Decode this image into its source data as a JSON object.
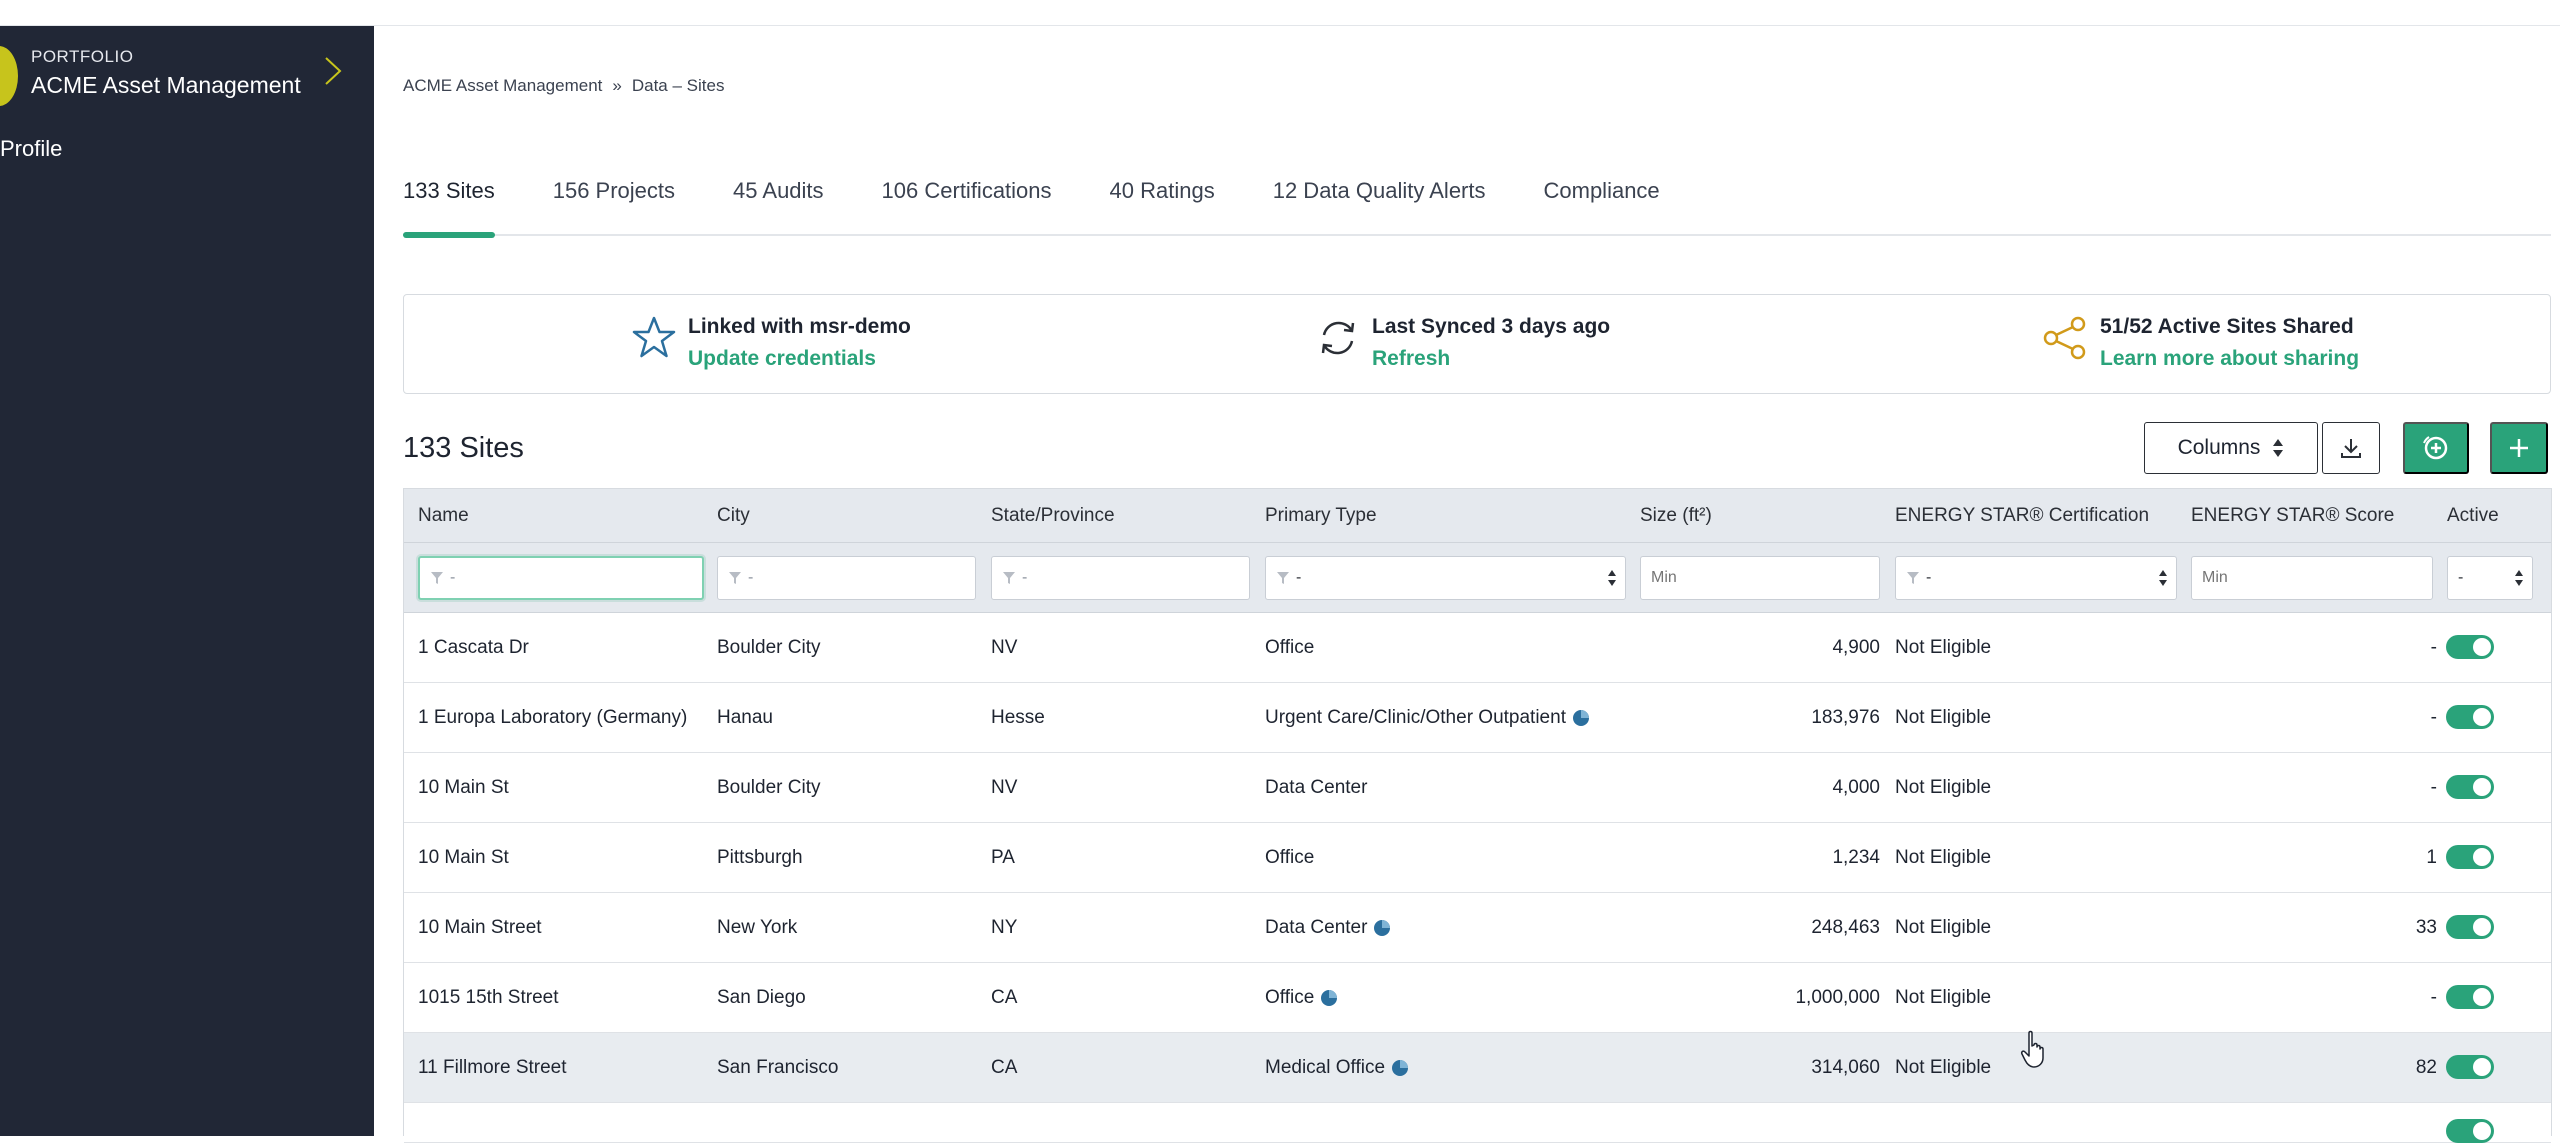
{
  "sidebar": {
    "portfolio_label": "PORTFOLIO",
    "portfolio_name": "ACME Asset Management",
    "profile_label": "Profile"
  },
  "breadcrumb": {
    "root": "ACME Asset Management",
    "separator": "»",
    "current": "Data – Sites"
  },
  "tabs": [
    {
      "label": "133 Sites",
      "active": true
    },
    {
      "label": "156 Projects"
    },
    {
      "label": "45 Audits"
    },
    {
      "label": "106 Certifications"
    },
    {
      "label": "40 Ratings"
    },
    {
      "label": "12 Data Quality Alerts"
    },
    {
      "label": "Compliance"
    }
  ],
  "info": {
    "linked_title": "Linked with msr-demo",
    "linked_link": "Update credentials",
    "sync_title": "Last Synced 3 days ago",
    "sync_link": "Refresh",
    "share_title": "51/52 Active Sites Shared",
    "share_link": "Learn more about sharing"
  },
  "section_title": "133 Sites",
  "toolbar": {
    "columns_label": "Columns"
  },
  "table": {
    "headers": {
      "name": "Name",
      "city": "City",
      "state": "State/Province",
      "type": "Primary Type",
      "size": "Size (ft²)",
      "cert": "ENERGY STAR® Certification",
      "score": "ENERGY STAR® Score",
      "active": "Active"
    },
    "filters": {
      "name": "-",
      "city": "-",
      "state": "-",
      "type": "-",
      "size_placeholder": "Min",
      "cert": "-",
      "score_placeholder": "Min",
      "active": "-"
    },
    "rows": [
      {
        "name": "1 Cascata Dr",
        "city": "Boulder City",
        "state": "NV",
        "type": "Office",
        "pie": false,
        "size": "4,900",
        "cert": "Not Eligible",
        "score": "-"
      },
      {
        "name": "1 Europa Laboratory (Germany)",
        "city": "Hanau",
        "state": "Hesse",
        "type": "Urgent Care/Clinic/Other Outpatient",
        "pie": true,
        "size": "183,976",
        "cert": "Not Eligible",
        "score": "-"
      },
      {
        "name": "10 Main St",
        "city": "Boulder City",
        "state": "NV",
        "type": "Data Center",
        "pie": false,
        "size": "4,000",
        "cert": "Not Eligible",
        "score": "-"
      },
      {
        "name": "10 Main St",
        "city": "Pittsburgh",
        "state": "PA",
        "type": "Office",
        "pie": false,
        "size": "1,234",
        "cert": "Not Eligible",
        "score": "1"
      },
      {
        "name": "10 Main Street",
        "city": "New York",
        "state": "NY",
        "type": "Data Center",
        "pie": true,
        "size": "248,463",
        "cert": "Not Eligible",
        "score": "33"
      },
      {
        "name": "1015 15th Street",
        "city": "San Diego",
        "state": "CA",
        "type": "Office",
        "pie": true,
        "size": "1,000,000",
        "cert": "Not Eligible",
        "score": "-"
      },
      {
        "name": "11 Fillmore Street",
        "city": "San Francisco",
        "state": "CA",
        "type": "Medical Office",
        "pie": true,
        "size": "314,060",
        "cert": "Not Eligible",
        "score": "82"
      }
    ]
  },
  "colors": {
    "accent": "#2aa37a",
    "sidebar_bg": "#212736",
    "pie_blue": "#2b6f9e",
    "share_icon": "#d19a1a",
    "star_icon": "#2b6f9e"
  }
}
